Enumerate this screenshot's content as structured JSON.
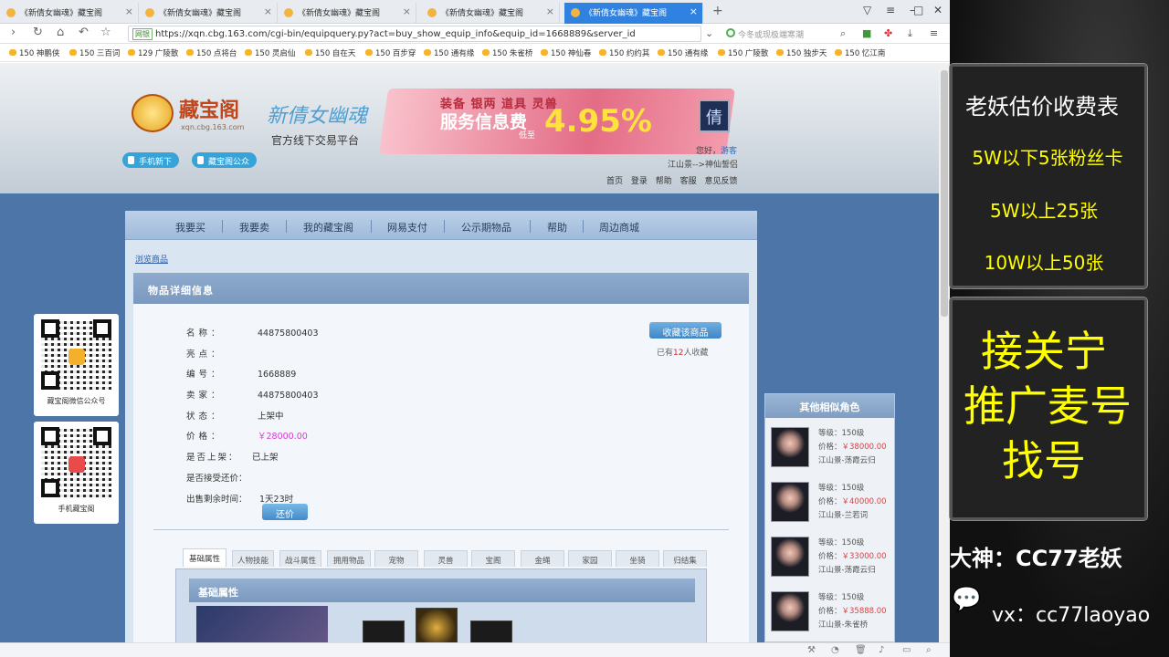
{
  "tabs": [
    {
      "label": "《新倩女幽魂》藏宝阁",
      "active": false
    },
    {
      "label": "《新倩女幽魂》藏宝阁",
      "active": false
    },
    {
      "label": "《新倩女幽魂》藏宝阁",
      "active": false
    },
    {
      "label": "《新倩女幽魂》藏宝阁",
      "active": false
    },
    {
      "label": "《新倩女幽魂》藏宝阁",
      "active": true
    }
  ],
  "address": {
    "badge": "网银",
    "url": "https://xqn.cbg.163.com/cgi-bin/equipquery.py?act=buy_show_equip_info&equip_id=1668889&server_id",
    "search_placeholder": "今冬或现极端寒潮"
  },
  "bookmarks": [
    "150 神鹏侠",
    "150 三百词",
    "129 广陵散",
    "150 点将台",
    "150 灵启仙",
    "150 自在天",
    "150 百步穿",
    "150 通有缘",
    "150 朱雀桥",
    "150 神仙春",
    "150 约约其",
    "150 通有缘",
    "150 广陵散",
    "150 独步天",
    "150 忆江南"
  ],
  "banner": {
    "logo_name": "藏宝阁",
    "logo_site": "xqn.cbg.163.com",
    "game_logo": "新倩女幽魂",
    "tagline": "官方线下交易平台",
    "promo_items": "装备 银两 道具 灵兽",
    "promo_main": "服务信息费",
    "promo_low": "低至",
    "promo_rate": "4.95%",
    "promo_badge": "倩",
    "mobile_btn": "手机新下",
    "wechat_btn": "藏宝阁公众",
    "greet": "您好，",
    "greet_link": "游客",
    "server": "江山景-->神仙誓侣",
    "topnav": "首页 登录 帮助 客服 意见反馈"
  },
  "mainnav": [
    "我要买",
    "我要卖",
    "我的藏宝阁",
    "网易支付",
    "公示期物品",
    "帮助",
    "周边商城"
  ],
  "breadcrumb": "浏览商品",
  "detail": {
    "header": "物品详细信息",
    "fields": [
      {
        "label": "名称：",
        "value": "44875800403"
      },
      {
        "label": "亮点：",
        "value": ""
      },
      {
        "label": "编号：",
        "value": "1668889"
      },
      {
        "label": "卖家：",
        "value": "44875800403"
      },
      {
        "label": "状态：",
        "value": "上架中"
      },
      {
        "label": "价格：",
        "value": "￥28000.00"
      }
    ],
    "listed_label": "是否上架：",
    "listed_value": "已上架",
    "bargain_label": "是否接受还价：",
    "bargain_btn": "还价",
    "remaining_label": "出售剩余时间：",
    "remaining_value": "1天23时",
    "fav_btn": "收藏该商品",
    "fav_pre": "已有",
    "fav_count": "12",
    "fav_post": "人收藏"
  },
  "prop_tabs": [
    "基础属性",
    "人物技能",
    "战斗属性",
    "拥用物品",
    "宠物",
    "灵兽",
    "宝阁",
    "金绳",
    "家园",
    "坐骑",
    "归结集"
  ],
  "attr_header": "基础属性",
  "similar": {
    "title": "其他相似角色",
    "items": [
      {
        "level": "等级：150级",
        "price_label": "价格：",
        "price": "￥38000.00",
        "server": "江山景-荡霞云归"
      },
      {
        "level": "等级：150级",
        "price_label": "价格：",
        "price": "￥40000.00",
        "server": "江山景-兰若词"
      },
      {
        "level": "等级：150级",
        "price_label": "价格：",
        "price": "￥33000.00",
        "server": "江山景-荡霞云归"
      },
      {
        "level": "等级：150级",
        "price_label": "价格：",
        "price": "￥35888.00",
        "server": "江山景-朱雀桥"
      }
    ]
  },
  "qr": [
    {
      "caption": "藏宝阁微信公众号"
    },
    {
      "caption": "手机藏宝阁"
    }
  ],
  "stream": {
    "price_title": "老妖估价收费表",
    "tier1": "5W以下5张粉丝卡",
    "tier2": "5W以上25张",
    "tier3": "10W以上50张",
    "promo1": "接关宁",
    "promo2": "推广麦号",
    "promo3": "找号",
    "streamer": "大神：CC77老妖",
    "contact": "vx：cc77laoyao"
  }
}
